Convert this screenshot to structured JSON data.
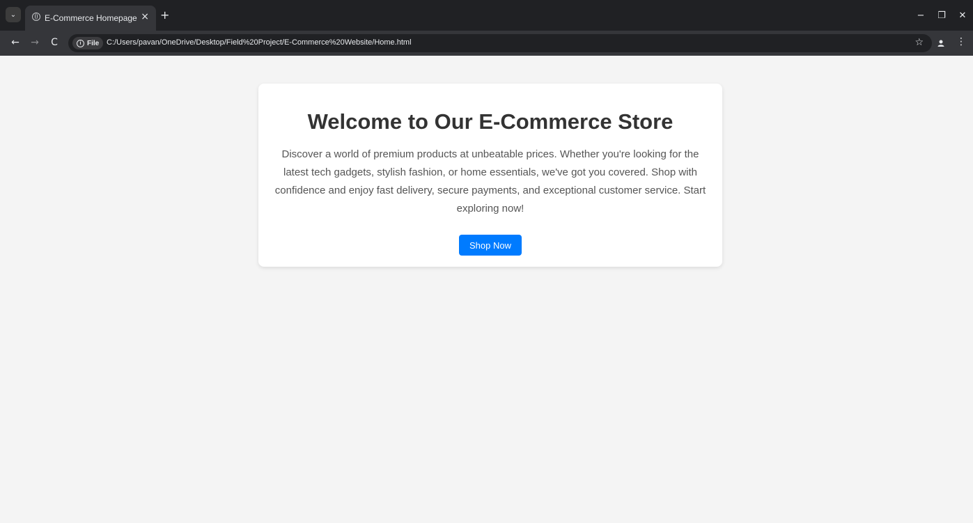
{
  "browser": {
    "tab_title": "E-Commerce Homepage",
    "tab_close": "×",
    "new_tab": "+",
    "window_controls": {
      "minimize": "−",
      "restore": "❐",
      "close": "✕"
    },
    "nav": {
      "back": "←",
      "forward": "→",
      "reload": "C"
    },
    "omnibox": {
      "scheme_chip": "File",
      "info_icon": "i",
      "url": "C:/Users/pavan/OneDrive/Desktop/Field%20Project/E-Commerce%20Website/Home.html"
    },
    "toolbar_icons": {
      "bookmark": "☆",
      "menu": "⋮"
    }
  },
  "page": {
    "heading": "Welcome to Our E-Commerce Store",
    "description": "Discover a world of premium products at unbeatable prices. Whether you're looking for the latest tech gadgets, stylish fashion, or home essentials, we've got you covered. Shop with confidence and enjoy fast delivery, secure payments, and exceptional customer service. Start exploring now!",
    "cta_label": "Shop Now"
  },
  "colors": {
    "page_background": "#f4f4f4",
    "card_background": "#ffffff",
    "button_background": "#007bff",
    "heading_color": "#333333",
    "text_color": "#555555"
  }
}
